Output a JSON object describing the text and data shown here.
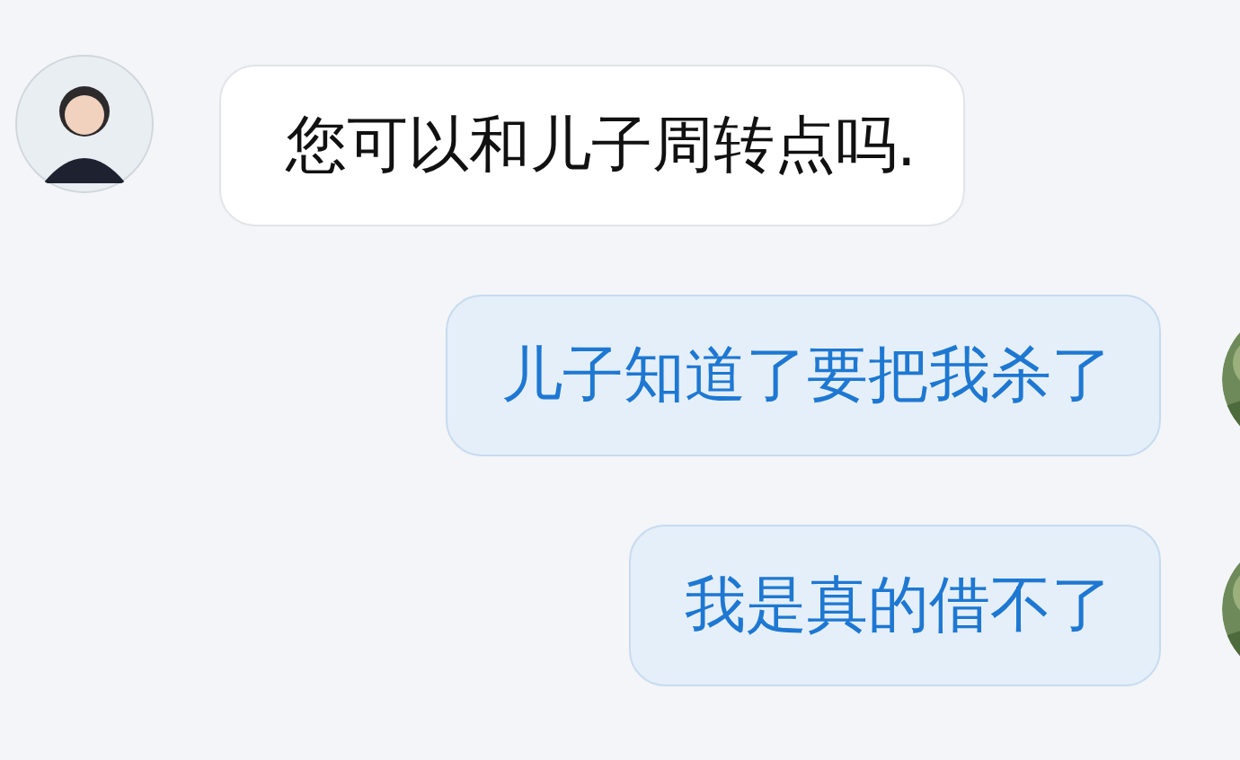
{
  "messages": [
    {
      "kind": "incoming",
      "text": "您可以和儿子周转点吗."
    },
    {
      "kind": "outgoing",
      "text": "儿子知道了要把我杀了"
    },
    {
      "kind": "outgoing",
      "text": "我是真的借不了"
    }
  ]
}
